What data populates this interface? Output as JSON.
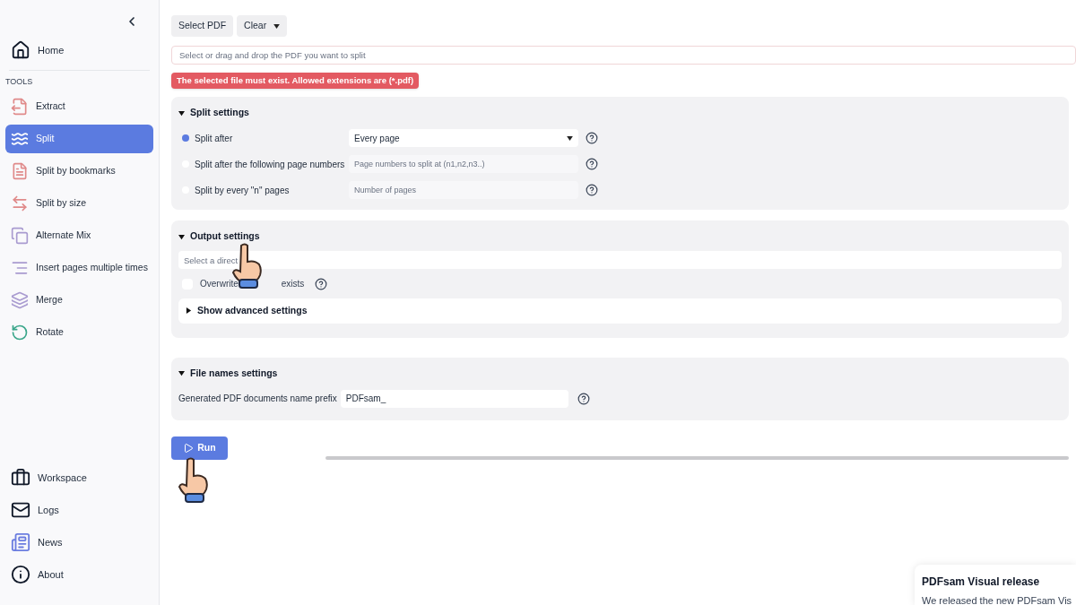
{
  "sidebar": {
    "home": {
      "label": "Home"
    },
    "section_label": "TOOLS",
    "tools": [
      {
        "label": "Extract",
        "selected": false
      },
      {
        "label": "Split",
        "selected": true
      },
      {
        "label": "Split by bookmarks",
        "selected": false
      },
      {
        "label": "Split by size",
        "selected": false
      },
      {
        "label": "Alternate Mix",
        "selected": false
      },
      {
        "label": "Insert pages multiple times",
        "selected": false
      },
      {
        "label": "Merge",
        "selected": false
      },
      {
        "label": "Rotate",
        "selected": false
      }
    ],
    "bottom": [
      {
        "label": "Workspace"
      },
      {
        "label": "Logs"
      },
      {
        "label": "News"
      },
      {
        "label": "About"
      }
    ]
  },
  "toolbar": {
    "select": "Select PDF",
    "clear": "Clear"
  },
  "file_field": {
    "placeholder": "Select or drag and drop the PDF you want to split"
  },
  "error": "The selected file must exist. Allowed extensions are (*.pdf)",
  "split_settings": {
    "title": "Split settings",
    "expanded": true,
    "options": [
      {
        "label": "Split after",
        "selected": true,
        "kind": "select",
        "value": "Every page"
      },
      {
        "label": "Split after the following page numbers",
        "selected": false,
        "kind": "input",
        "placeholder": "Page numbers to split at (n1,n2,n3..)"
      },
      {
        "label": "Split by every \"n\" pages",
        "selected": false,
        "kind": "input",
        "placeholder": "Number of pages"
      }
    ]
  },
  "output_settings": {
    "title": "Output settings",
    "expanded": true,
    "directory_placeholder": "Select a direct",
    "overwrite": {
      "label_start": "Overwrite",
      "label_end": "exists",
      "checked": false
    },
    "advanced": {
      "label": "Show advanced settings",
      "expanded": false
    }
  },
  "file_names": {
    "title": "File names settings",
    "expanded": true,
    "prefix_label": "Generated PDF documents name prefix",
    "prefix_value": "PDFsam_"
  },
  "run": "Run",
  "progress": {
    "level": 0
  },
  "notification": {
    "title": "PDFsam Visual release",
    "body": "We released the new PDFsam Vis"
  }
}
